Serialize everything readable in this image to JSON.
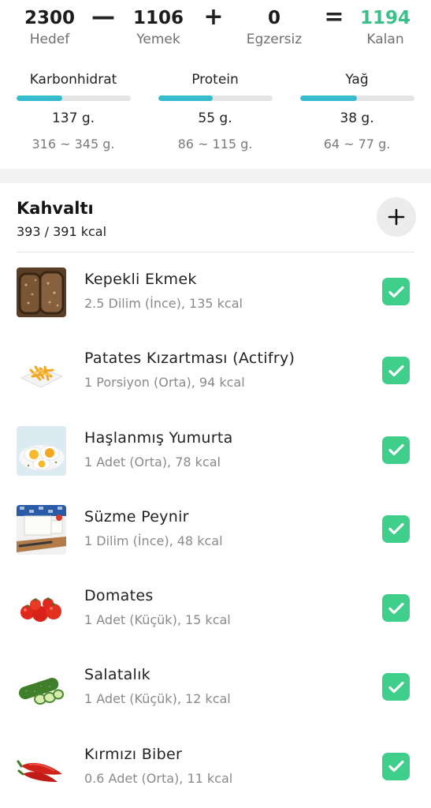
{
  "summary": {
    "goal": {
      "value": "2300",
      "label": "Hedef"
    },
    "food": {
      "value": "1106",
      "label": "Yemek"
    },
    "exercise": {
      "value": "0",
      "label": "Egzersiz"
    },
    "remaining": {
      "value": "1194",
      "label": "Kalan"
    },
    "operators": {
      "minus": "—",
      "plus": "+",
      "equals": "="
    },
    "remaining_color": "#3cc089"
  },
  "macros": [
    {
      "name": "Karbonhidrat",
      "value": "137 g.",
      "range": "316 ~ 345 g.",
      "progress": 0.4
    },
    {
      "name": "Protein",
      "value": "55 g.",
      "range": "86 ~ 115 g.",
      "progress": 0.48
    },
    {
      "name": "Yağ",
      "value": "38 g.",
      "range": "64 ~ 77 g.",
      "progress": 0.5
    }
  ],
  "meal": {
    "title": "Kahvaltı",
    "calories": "393 / 391 kcal",
    "add_icon": "plus-icon",
    "items": [
      {
        "name": "Kepekli Ekmek",
        "detail": "2.5 Dilim (İnce), 135 kcal",
        "image": "bread-image",
        "checked": true
      },
      {
        "name": "Patates Kızartması (Actifry)",
        "detail": "1 Porsiyon (Orta), 94 kcal",
        "image": "fries-image",
        "checked": true
      },
      {
        "name": "Haşlanmış Yumurta",
        "detail": "1 Adet (Orta), 78 kcal",
        "image": "boiled-egg-image",
        "checked": true
      },
      {
        "name": "Süzme Peynir",
        "detail": "1 Dilim (İnce), 48 kcal",
        "image": "cheese-image",
        "checked": true
      },
      {
        "name": "Domates",
        "detail": "1 Adet (Küçük), 15 kcal",
        "image": "tomato-image",
        "checked": true
      },
      {
        "name": "Salatalık",
        "detail": "1 Adet (Küçük), 12 kcal",
        "image": "cucumber-image",
        "checked": true
      },
      {
        "name": "Kırmızı Biber",
        "detail": "0.6 Adet (Orta), 11 kcal",
        "image": "red-pepper-image",
        "checked": true
      }
    ]
  },
  "colors": {
    "accent_green": "#3fcf8a",
    "progress_blue": "#36bccd"
  }
}
